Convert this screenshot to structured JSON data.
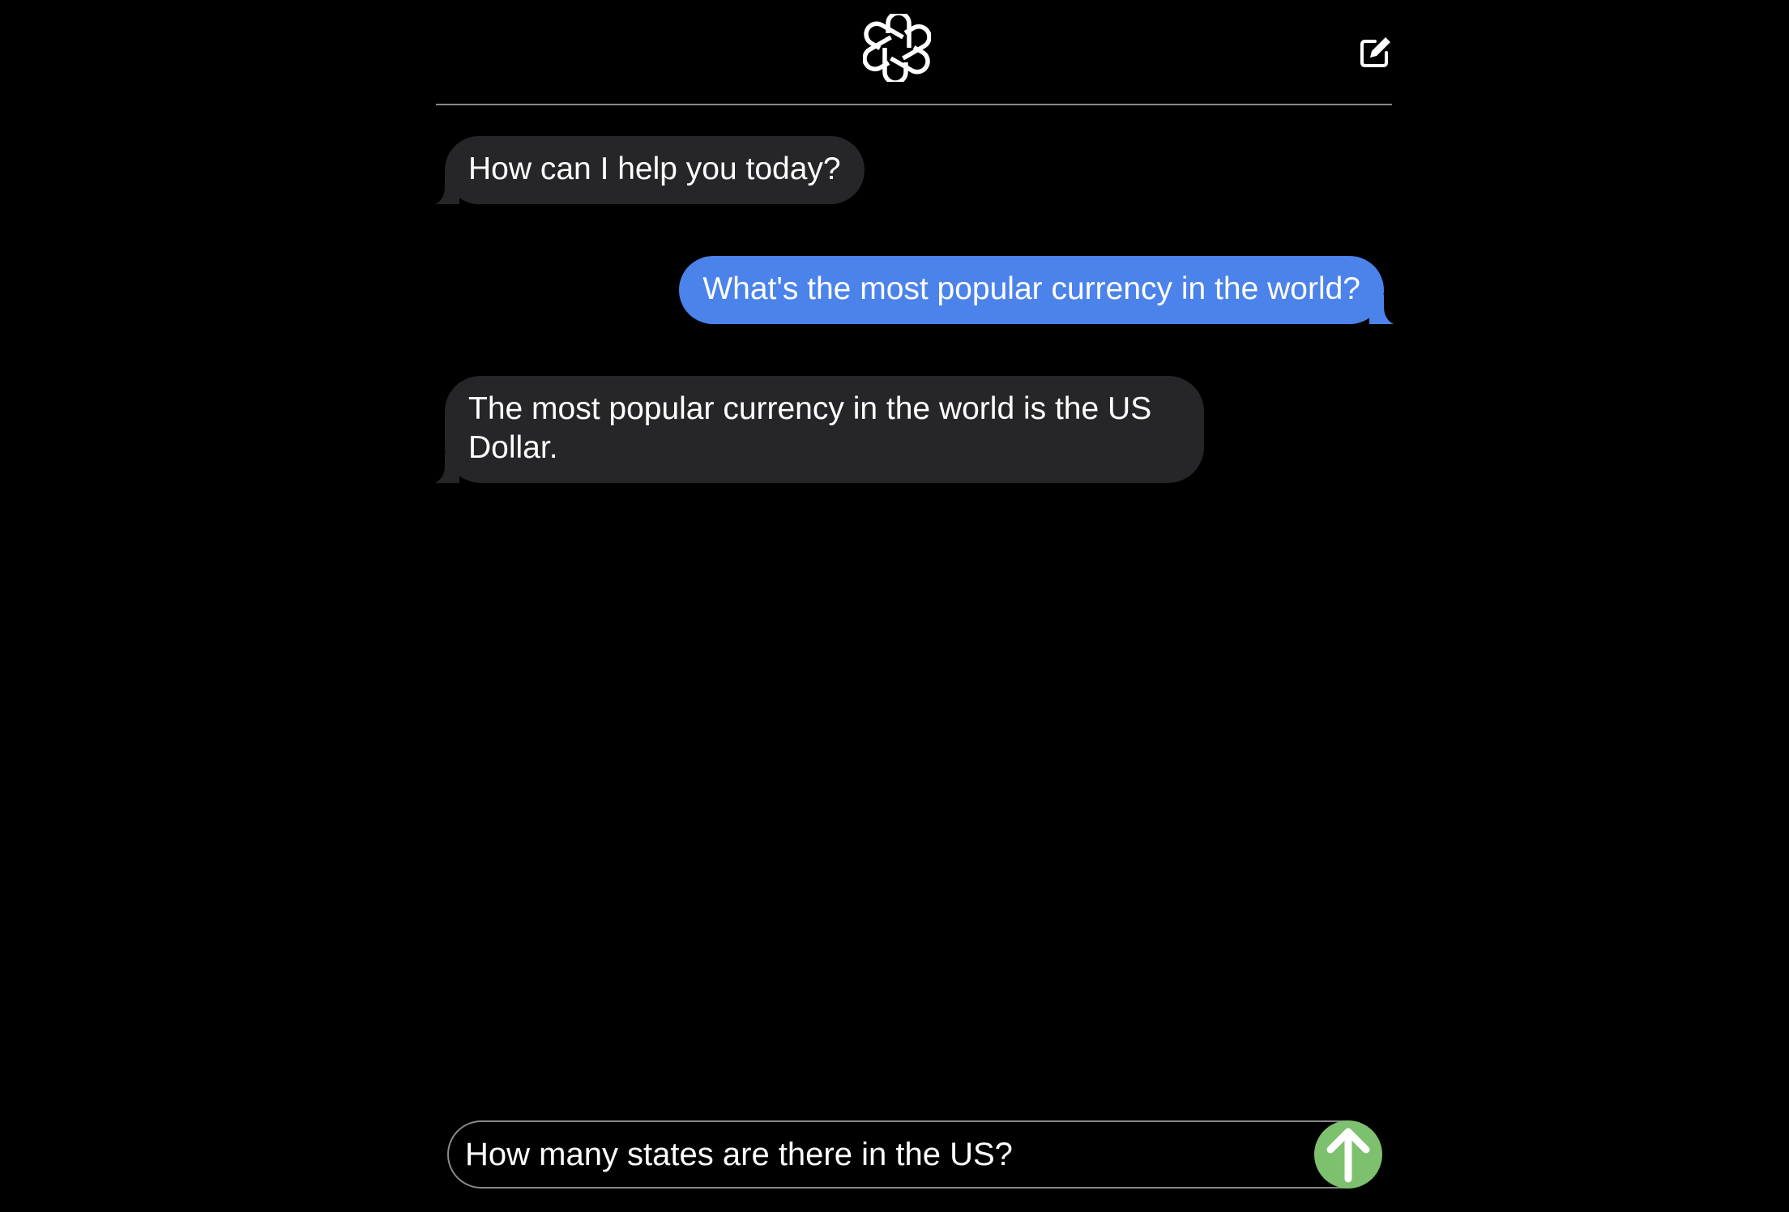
{
  "header": {
    "logo_icon": "openai-logo-icon",
    "compose_icon": "compose-edit-icon"
  },
  "messages": [
    {
      "role": "assistant",
      "text": "How can I help you today?"
    },
    {
      "role": "user",
      "text": "What's the most popular currency in the world?"
    },
    {
      "role": "assistant",
      "text": "The most popular currency in the world is the US Dollar."
    }
  ],
  "composer": {
    "value": "How many states are there in the US?",
    "send_icon": "arrow-up-icon"
  },
  "colors": {
    "background": "#000000",
    "assistant_bubble": "#262628",
    "user_bubble": "#4b83ea",
    "send_button": "#7dc06d"
  }
}
